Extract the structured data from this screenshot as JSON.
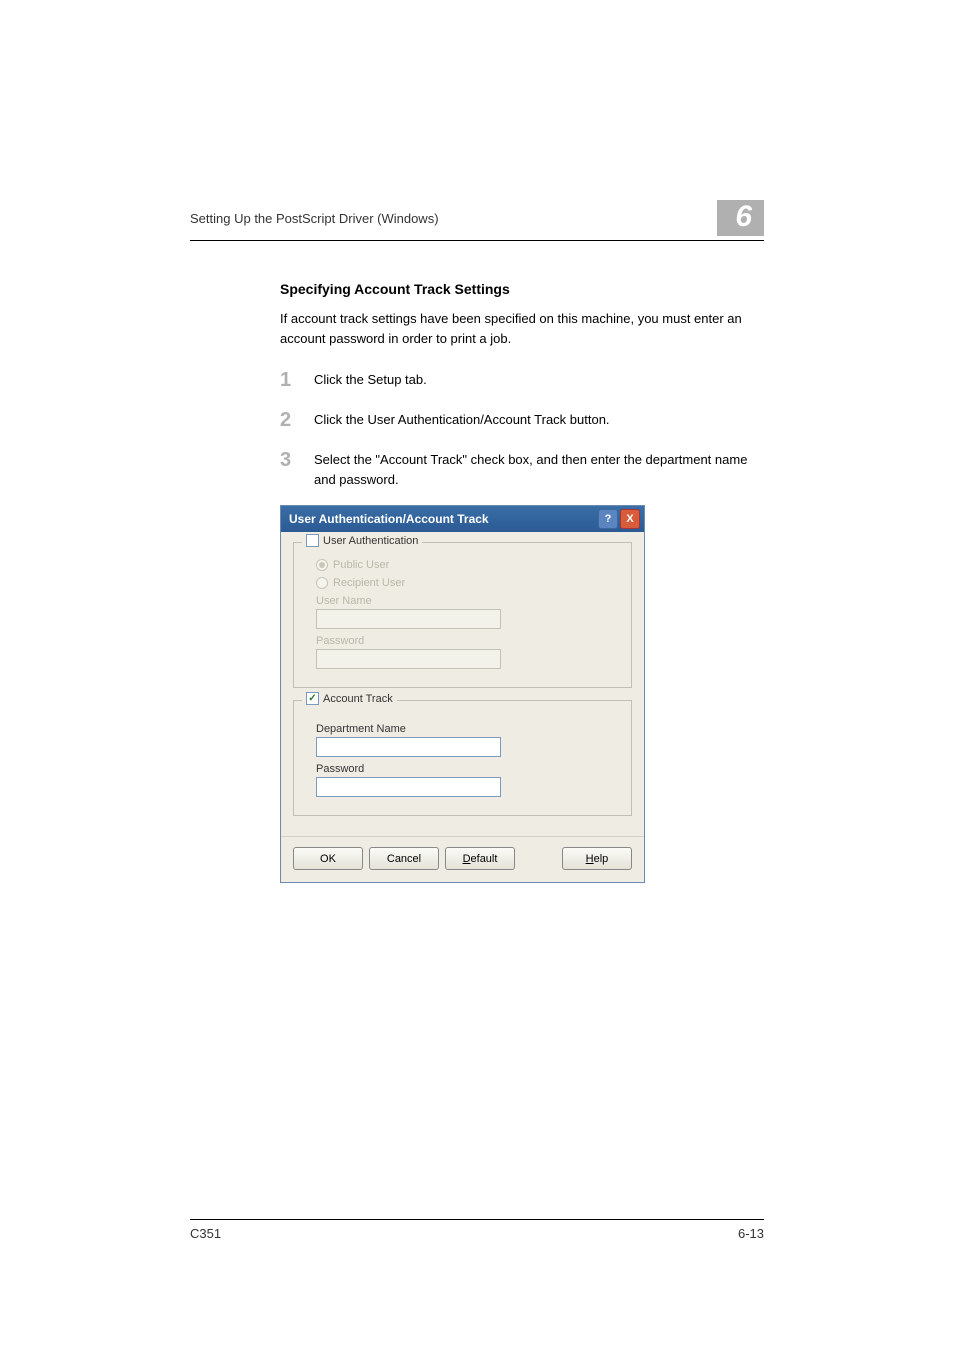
{
  "header": {
    "title": "Setting Up the PostScript Driver (Windows)",
    "chapter_number": "6"
  },
  "section": {
    "heading": "Specifying Account Track Settings",
    "intro": "If account track settings have been specified on this machine, you must enter an account password in order to print a job."
  },
  "steps": [
    {
      "num": "1",
      "text": "Click the Setup tab."
    },
    {
      "num": "2",
      "text": "Click the User Authentication/Account Track button."
    },
    {
      "num": "3",
      "text": "Select the \"Account Track\" check box, and then enter the department name and password."
    }
  ],
  "dialog": {
    "title": "User Authentication/Account Track",
    "help_btn": "?",
    "close_btn": "X",
    "user_auth": {
      "checkbox_label": "User Authentication",
      "public_user": "Public User",
      "recipient_user": "Recipient User",
      "user_name_label": "User Name",
      "password_label": "Password"
    },
    "account_track": {
      "checkbox_label": "Account Track",
      "department_label": "Department Name",
      "password_label": "Password"
    },
    "buttons": {
      "ok": "OK",
      "cancel": "Cancel",
      "default_u": "D",
      "default_rest": "efault",
      "help_u": "H",
      "help_rest": "elp"
    }
  },
  "footer": {
    "model": "C351",
    "page": "6-13"
  }
}
